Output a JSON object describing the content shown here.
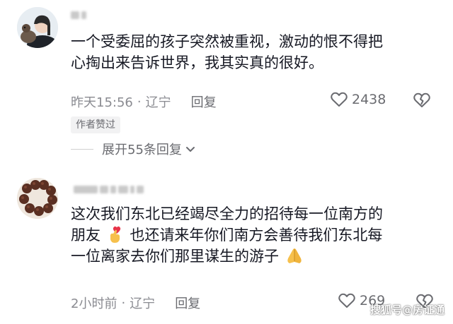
{
  "comments": [
    {
      "username": "",
      "text_lines": [
        "一个受委屈的孩子突然被重视，激动的恨不得把",
        "心掏出来告诉世界，我其实真的很好。"
      ],
      "time": "昨天15:56",
      "location": "辽宁",
      "reply_label": "回复",
      "likes": "2438",
      "badge": "作者赞过",
      "expand_label": "展开55条回复"
    },
    {
      "username": "",
      "text_lines": [
        "这次我们东北已经竭尽全力的招待每一位南方的",
        "朋友",
        "也还请来年你们南方会善待我们东北每",
        "一位离家去你们那里谋生的游子"
      ],
      "time": "2小时前",
      "location": "辽宁",
      "reply_label": "回复",
      "likes": "269"
    }
  ],
  "icons": {
    "like": "heart-outline-icon",
    "dislike": "broken-heart-icon",
    "expand": "chevron-down-icon",
    "emoji1": "finger-heart-emoji",
    "emoji2": "folded-hands-emoji"
  },
  "watermark": "搜狐号@房证通",
  "colors": {
    "text": "#161823",
    "meta": "#8a8b91",
    "badge_bg": "#f2f2f3"
  }
}
